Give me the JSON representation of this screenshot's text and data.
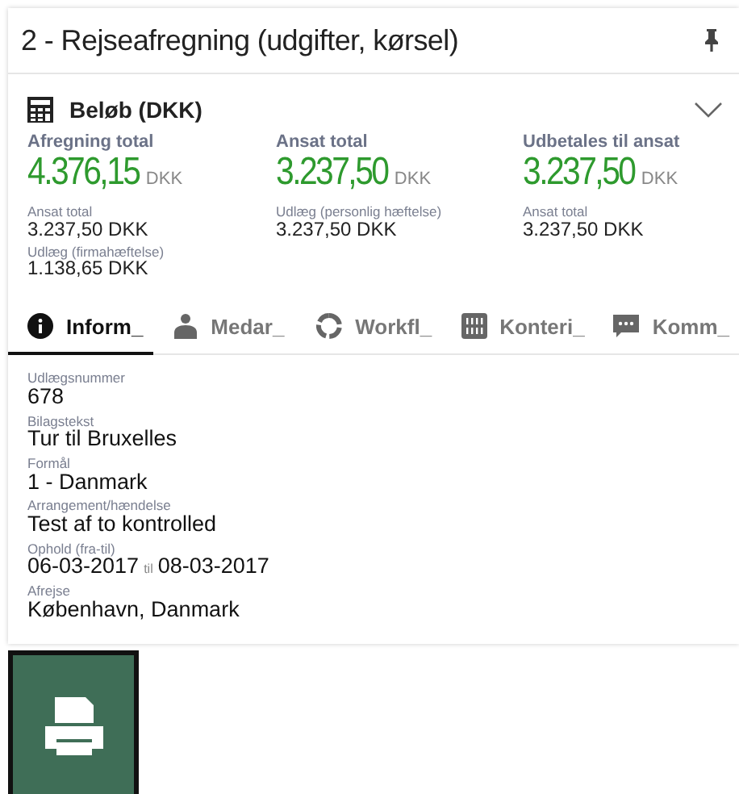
{
  "card": {
    "title": "2 - Rejseafregning (udgifter, kørsel)"
  },
  "amounts": {
    "title": "Beløb (DKK)",
    "expanded": true,
    "columns": [
      {
        "label": "Afregning total",
        "value": "4.376,15",
        "currency": "DKK",
        "details": [
          {
            "label": "Ansat total",
            "value": "3.237,50 DKK"
          },
          {
            "label": "Udlæg (firmahæftelse)",
            "value": "1.138,65 DKK"
          }
        ]
      },
      {
        "label": "Ansat total",
        "value": "3.237,50",
        "currency": "DKK",
        "details": [
          {
            "label": "Udlæg (personlig hæftelse)",
            "value": "3.237,50 DKK"
          }
        ]
      },
      {
        "label": "Udbetales til ansat",
        "value": "3.237,50",
        "currency": "DKK",
        "details": [
          {
            "label": "Ansat total",
            "value": "3.237,50 DKK"
          }
        ]
      }
    ]
  },
  "tabs": [
    {
      "label": "Inform_",
      "kind": "info",
      "selected": true
    },
    {
      "label": "Medar_",
      "kind": "person",
      "selected": false
    },
    {
      "label": "Workfl_",
      "kind": "workflow",
      "selected": false
    },
    {
      "label": "Konteri_",
      "kind": "binary",
      "selected": false
    },
    {
      "label": "Komm_",
      "kind": "comment",
      "selected": false
    }
  ],
  "fields": [
    {
      "label": "Udlægsnummer",
      "value": "678"
    },
    {
      "label": "Bilagstekst",
      "value": "Tur til Bruxelles"
    },
    {
      "label": "Formål",
      "value": "1 - Danmark"
    },
    {
      "label": "Arrangement/hændelse",
      "value": "Test af to kontrolled"
    },
    {
      "label": "Ophold (fra-til)",
      "kind": "range",
      "from": "06-03-2017",
      "sep": "til",
      "to": "08-03-2017"
    },
    {
      "label": "Afrejse",
      "value": "København, Danmark"
    }
  ]
}
